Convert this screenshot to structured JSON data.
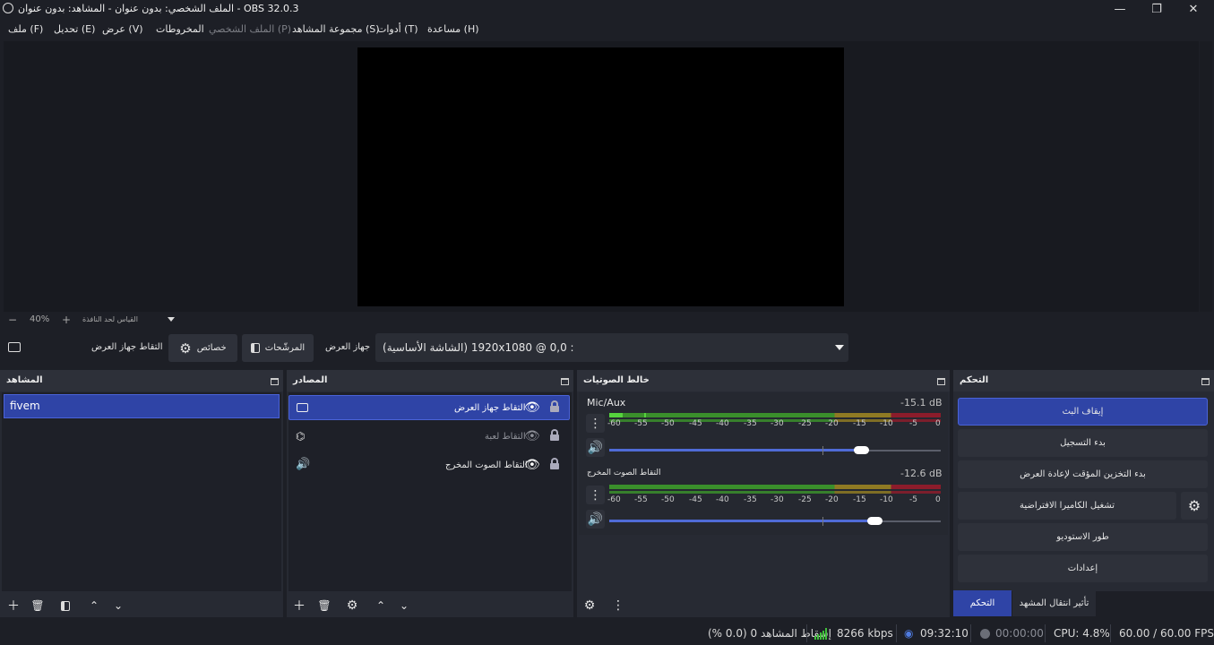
{
  "window": {
    "title": "الملف الشخصي: بدون عنوان - المشاهد: بدون عنوان - OBS 32.0.3",
    "minimize_glyph": "—",
    "maximize_glyph": "❐",
    "close_glyph": "✕"
  },
  "menu": {
    "file": "ملف (F)",
    "edit": "تحديل (E)",
    "view": "عرض (V)",
    "docks": "المخروطات",
    "profile": "الملف الشخصي (P)",
    "scene_collection": "مجموعة المشاهد (S)",
    "tools": "أدوات (T)",
    "help": "مساعدة (H)"
  },
  "preview": {
    "zoom_minus": "−",
    "zoom_level": "40%",
    "zoom_plus": "+",
    "scale_label": "القياس لحد النافذة"
  },
  "source_toolbar": {
    "source_name": "التقاط جهاز العرض",
    "properties_label": "خصائص",
    "filters_label": "المرشّحات",
    "display_label": "جهاز العرض",
    "display_value": "(الشاشة الأساسية) 1920x1080 @ 0,0 :"
  },
  "scenes_dock": {
    "title": "المشاهد",
    "items": [
      {
        "label": "fivem"
      }
    ]
  },
  "sources_dock": {
    "title": "المصادر",
    "items": [
      {
        "label": "التقاط جهاز العرض"
      },
      {
        "label": "التقاط لعبة"
      },
      {
        "label": "التقاط الصوت المخرج"
      }
    ]
  },
  "mixer_dock": {
    "title": "خالط الصوتيات",
    "channels": [
      {
        "name": "Mic/Aux",
        "db": "-15.1 dB",
        "volume": 0.76
      },
      {
        "name": "التقاط الصوت المخرج",
        "db": "-12.6 dB",
        "volume": 0.8
      }
    ],
    "ticks": [
      "-60",
      "-55",
      "-50",
      "-45",
      "-40",
      "-35",
      "-30",
      "-25",
      "-20",
      "-15",
      "-10",
      "-5",
      "0"
    ]
  },
  "controls_dock": {
    "title": "التحكم",
    "stop_stream": "إيقاف البث",
    "start_recording": "بدء التسجيل",
    "start_replay_buffer": "بدء التخزين المؤقت لإعادة العرض",
    "start_virtual_camera": "تشغيل الكاميرا الافتراضية",
    "studio_mode": "طور الاستوديو",
    "settings": "إعدادات",
    "tab_controls": "التحكم",
    "tab_transitions": "تأثير انتقال المشهد"
  },
  "status": {
    "dropped_frames": "إسقاط المشاهد 0 (0.0 %)",
    "bitrate": "8266 kbps",
    "stream_time": "09:32:10",
    "record_time": "00:00:00",
    "cpu": "CPU: 4.8%",
    "fps": "60.00 / 60.00 FPS"
  },
  "colors": {
    "accent": "#2f44a6",
    "meter_green": "#3a8f2b",
    "meter_yellow": "#8f7a23",
    "meter_red": "#8c1c2b",
    "fader_blue": "#4f6bd6"
  }
}
